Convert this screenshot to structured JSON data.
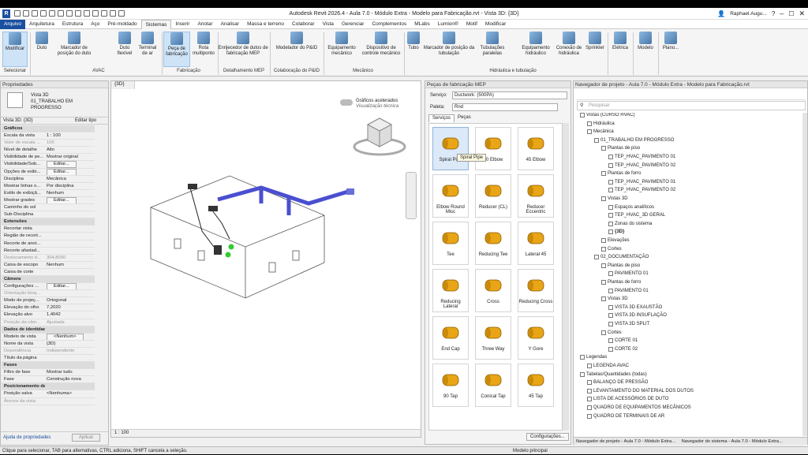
{
  "app": {
    "title": "Autodesk Revit 2026.4 - Aula 7.0 - Módulo Extra - Modelo para Fabricação.rvt - Vista 3D: {3D}",
    "user": "Raphael.Augu..."
  },
  "menu": [
    "Arquivo",
    "Arquitetura",
    "Estrutura",
    "Aço",
    "Pré-moldado",
    "Sistemas",
    "Inserir",
    "Anotar",
    "Analisar",
    "Massa e terreno",
    "Colaborar",
    "Vista",
    "Gerenciar",
    "Complementos",
    "MLabs",
    "Lumion®",
    "Motif",
    "Modificar"
  ],
  "ribbon": {
    "buttons": [
      "Modificar",
      "Duto",
      "Marcador de posição do duto",
      "Duto flexível",
      "Terminal de ar",
      "Peça de fabricação",
      "Rota multiponto",
      "Enrijecedor de dutos de fabricação MEP",
      "Modelador do P&ID",
      "Equipamento mecânico",
      "Dispositivo de controle mecânico",
      "Tubo",
      "Marcador de posição da tubulação",
      "Tubulações paralelas",
      "Equipamento hidráulico",
      "Conexão de hidráulica",
      "Sprinkler",
      "Elétrica",
      "Modelo",
      "Plano..."
    ],
    "groups": [
      "Selecionar",
      "AVAC",
      "Fabricação",
      "Detalhamento MEP",
      "Colaboração do P&ID",
      "Mecânico",
      "Hidráulica e tubulação"
    ]
  },
  "properties": {
    "title": "Propriedades",
    "type_line1": "Vista 3D",
    "type_line2": "01_TRABALHO EM",
    "type_line3": "PROGRESSO",
    "view_selector": "Vista 3D: {3D}",
    "edit_type": "Editar tipo",
    "rows": [
      {
        "k": "Gráficos",
        "v": "",
        "sec": true
      },
      {
        "k": "Escala da vista",
        "v": "1 : 100"
      },
      {
        "k": "Valor de escala ...",
        "v": "100",
        "gray": true
      },
      {
        "k": "Nível de detalhe",
        "v": "Alto"
      },
      {
        "k": "Visibilidade de pe...",
        "v": "Mostrar original"
      },
      {
        "k": "Visibilidade/Sob...",
        "v": "Editar...",
        "btn": true
      },
      {
        "k": "Opções de exibi...",
        "v": "Editar...",
        "btn": true
      },
      {
        "k": "Disciplina",
        "v": "Mecânica"
      },
      {
        "k": "Mostrar linhas o...",
        "v": "Por disciplina"
      },
      {
        "k": "Estilo de exibiçã...",
        "v": "Nenhum"
      },
      {
        "k": "Mostrar grades",
        "v": "Editar...",
        "btn": true
      },
      {
        "k": "Caminho do sol",
        "v": ""
      },
      {
        "k": "Sub-Disciplina",
        "v": ""
      },
      {
        "k": "Extensões",
        "v": "",
        "sec": true
      },
      {
        "k": "Recortar vista",
        "v": ""
      },
      {
        "k": "Região de recort...",
        "v": ""
      },
      {
        "k": "Recorte de anot...",
        "v": ""
      },
      {
        "k": "Recorte afastad...",
        "v": ""
      },
      {
        "k": "Deslocamento d...",
        "v": "304,8000",
        "gray": true
      },
      {
        "k": "Caixa de escopo",
        "v": "Nenhum"
      },
      {
        "k": "Caixa de corte",
        "v": ""
      },
      {
        "k": "Câmera",
        "v": "",
        "sec": true
      },
      {
        "k": "Configurações ...",
        "v": "Editar...",
        "btn": true
      },
      {
        "k": "Orientação bloq...",
        "v": "",
        "gray": true
      },
      {
        "k": "Modo de projeç...",
        "v": "Ortogonal"
      },
      {
        "k": "Elevação do olho",
        "v": "7,2020"
      },
      {
        "k": "Elevação alvo",
        "v": "1,4042"
      },
      {
        "k": "Posição da câm...",
        "v": "Ajustada",
        "gray": true
      },
      {
        "k": "Dados de identidade",
        "v": "",
        "sec": true
      },
      {
        "k": "Modelo de vista",
        "v": "<Nenhum>",
        "btn": true
      },
      {
        "k": "Nome da vista",
        "v": "{3D}"
      },
      {
        "k": "Dependência",
        "v": "Independente",
        "gray": true
      },
      {
        "k": "Título da página",
        "v": ""
      },
      {
        "k": "Fases",
        "v": "",
        "sec": true
      },
      {
        "k": "Filtro de fase",
        "v": "Mostrar tudo"
      },
      {
        "k": "Fase",
        "v": "Construção nova"
      },
      {
        "k": "Posicionamento da vista na folha",
        "v": "",
        "sec": true
      },
      {
        "k": "Posição salva",
        "v": "<Nenhuma>"
      },
      {
        "k": "Âncora da vista",
        "v": "",
        "gray": true
      }
    ],
    "help": "Ajuda de propriedades",
    "apply": "Aplicar"
  },
  "viewport": {
    "tab": "{3D}",
    "accel1": "Gráficos acelerados",
    "accel2": "Visualização técnica",
    "scale": "1 : 100"
  },
  "fabrication": {
    "title": "Peças de fabricação MEP",
    "service_label": "Serviço:",
    "service": "Ductwork: (500PA)",
    "palette_label": "Paleta:",
    "palette": "Rnd",
    "tabs": [
      "Serviços",
      "Peças"
    ],
    "tooltip": "Spiral Pipe",
    "items": [
      "Spiral Pipe",
      "90 Elbow",
      "45 Elbow",
      "Elbow Round Misc",
      "Reducer (CL)",
      "Reducer Eccentric",
      "Tee",
      "Reducing Tee",
      "Lateral 45",
      "Reducing Lateral",
      "Cross",
      "Reducing Cross",
      "End Cap",
      "Three Way",
      "Y Gore",
      "90 Tap",
      "Conical Tap",
      "45 Tap"
    ],
    "settings": "Configurações..."
  },
  "navigator": {
    "title": "Navegador de projeto - Aula 7.0 - Módulo Extra - Modelo para Fabricação.rvt",
    "search": "Pesquisar",
    "tree": [
      {
        "t": "Vistas (CURSO HVAC)",
        "l": 0
      },
      {
        "t": "Hidráulica",
        "l": 1
      },
      {
        "t": "Mecânica",
        "l": 1
      },
      {
        "t": "01_TRABALHO EM PROGRESSO",
        "l": 2
      },
      {
        "t": "Plantas de piso",
        "l": 3
      },
      {
        "t": "TEP_HVAC_PAVIMENTO 01",
        "l": 4
      },
      {
        "t": "TEP_HVAC_PAVIMENTO 02",
        "l": 4
      },
      {
        "t": "Plantas de forro",
        "l": 3
      },
      {
        "t": "TEP_HVAC_PAVIMENTO 01",
        "l": 4
      },
      {
        "t": "TEP_HVAC_PAVIMENTO 02",
        "l": 4
      },
      {
        "t": "Vistas 3D",
        "l": 3
      },
      {
        "t": "Espaços analíticos",
        "l": 4
      },
      {
        "t": "TEP_HVAC_3D GERAL",
        "l": 4
      },
      {
        "t": "Zonas do sistema",
        "l": 4
      },
      {
        "t": "{3D}",
        "l": 4,
        "b": true
      },
      {
        "t": "Elevações",
        "l": 3
      },
      {
        "t": "Cortes",
        "l": 3
      },
      {
        "t": "02_DOCUMENTAÇÃO",
        "l": 2
      },
      {
        "t": "Plantas de piso",
        "l": 3
      },
      {
        "t": "PAVIMENTO 01",
        "l": 4
      },
      {
        "t": "Plantas de forro",
        "l": 3
      },
      {
        "t": "PAVIMENTO 01",
        "l": 4
      },
      {
        "t": "Vistas 3D",
        "l": 3
      },
      {
        "t": "VISTA 3D EXAUSTÃO",
        "l": 4
      },
      {
        "t": "VISTA 3D INSUFLAÇÃO",
        "l": 4
      },
      {
        "t": "VISTA 3D SPLIT",
        "l": 4
      },
      {
        "t": "Cortes",
        "l": 3
      },
      {
        "t": "CORTE 01",
        "l": 4
      },
      {
        "t": "CORTE 02",
        "l": 4
      },
      {
        "t": "Legendas",
        "l": 0
      },
      {
        "t": "LEGENDA AVAC",
        "l": 1
      },
      {
        "t": "Tabelas/Quantidades (todas)",
        "l": 0
      },
      {
        "t": "BALANÇO DE PRESSÃO",
        "l": 1
      },
      {
        "t": "LEVANTAMENTO DO MATERIAL DOS DUTOS",
        "l": 1
      },
      {
        "t": "LISTA DE ACESSÓRIOS DE DUTO",
        "l": 1
      },
      {
        "t": "QUADRO DE EQUIPAMENTOS MECÂNICOS",
        "l": 1
      },
      {
        "t": "QUADRO DE TERMINAIS DE AR",
        "l": 1
      }
    ],
    "bottom_tab1": "Navegador de projeto - Aula 7.0 - Módulo Extra...",
    "bottom_tab2": "Navegador do sistema - Aula 7.0 - Módulo Extra..."
  },
  "status": {
    "hint": "Clique para selecionar, TAB para alternativas, CTRL adiciona, SHIFT cancela a seleção.",
    "model": "Modelo principal"
  },
  "colors": {
    "brand": "#1b4fa0",
    "duct": "#4a4fd0",
    "fitting": "#e8a516"
  }
}
